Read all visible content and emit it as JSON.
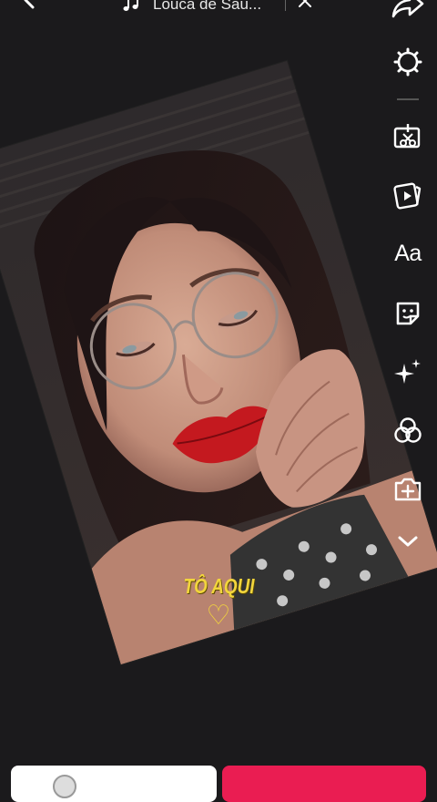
{
  "top_bar": {
    "sound_title": "Louca de Sau...",
    "icons": [
      "back-arrow-icon",
      "music-note-icon",
      "close-icon",
      "share-arrow-icon"
    ]
  },
  "toolbar": {
    "items": [
      {
        "name": "settings",
        "icon": "gear-icon"
      },
      {
        "name": "cut",
        "icon": "scissors-icon"
      },
      {
        "name": "template",
        "icon": "video-template-icon"
      },
      {
        "name": "text",
        "label": "Aa"
      },
      {
        "name": "stickers",
        "icon": "sticker-icon"
      },
      {
        "name": "effects",
        "icon": "sparkle-icon"
      },
      {
        "name": "filters",
        "icon": "filters-icon"
      },
      {
        "name": "add-clip",
        "icon": "camera-plus-icon"
      },
      {
        "name": "more",
        "icon": "chevron-down-icon"
      }
    ]
  },
  "caption": {
    "text": "TÔ AQUI",
    "heart": "♡"
  },
  "colors": {
    "caption_yellow": "#f2d53c",
    "post_button": "#ea1d52",
    "background": "#1b1a1c"
  }
}
